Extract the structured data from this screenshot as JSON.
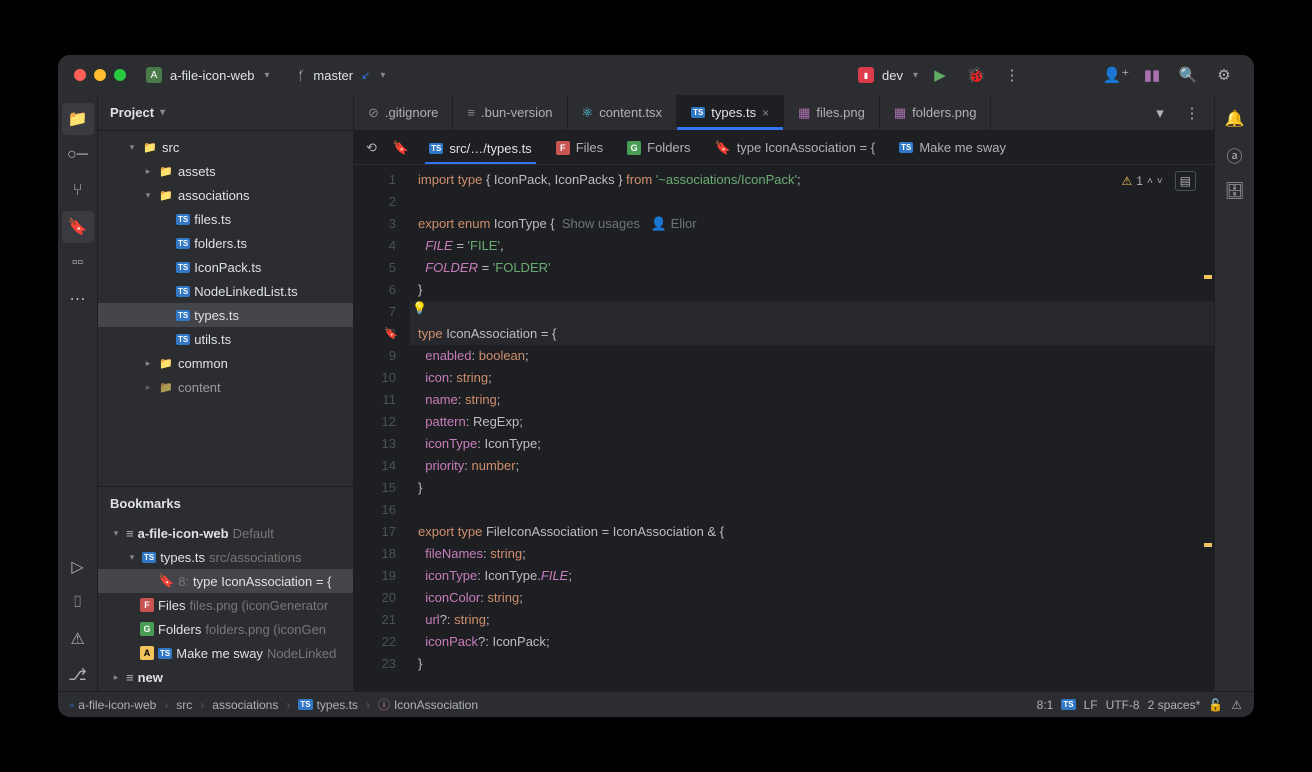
{
  "titlebar": {
    "project_name": "a-file-icon-web",
    "branch_icon": "⎇",
    "branch_name": "master",
    "dev_label": "dev"
  },
  "sidebar": {
    "header": "Project",
    "tree": {
      "src": "src",
      "assets": "assets",
      "associations": "associations",
      "files_ts": "files.ts",
      "folders_ts": "folders.ts",
      "iconpack_ts": "IconPack.ts",
      "nodelist_ts": "NodeLinkedList.ts",
      "types_ts": "types.ts",
      "utils_ts": "utils.ts",
      "common": "common",
      "content": "content"
    },
    "bookmarks_header": "Bookmarks",
    "bookmarks": {
      "root": "a-file-icon-web",
      "root_suffix": "Default",
      "types_ts": "types.ts",
      "types_ts_path": "src/associations",
      "line8_prefix": "8:",
      "line8_text": "type IconAssociation = {",
      "files": "Files",
      "files_dim": "files.png  (iconGenerator",
      "folders": "Folders",
      "folders_dim": "folders.png  (iconGen",
      "makemesway": "Make me sway",
      "makemesway_dim": "NodeLinked",
      "new": "new"
    }
  },
  "tabs": {
    "gitignore": ".gitignore",
    "bunversion": ".bun-version",
    "content": "content.tsx",
    "types": "types.ts",
    "filespng": "files.png",
    "folderspng": "folders.png"
  },
  "bmbar": {
    "path": "src/…/types.ts",
    "files": "Files",
    "folders": "Folders",
    "iconassoc": "type IconAssociation = {",
    "makemesway": "Make me sway"
  },
  "code": {
    "l1_a": "import",
    "l1_b": "type",
    "l1_c": "{ IconPack, IconPacks }",
    "l1_d": "from",
    "l1_e": "'~associations/IconPack'",
    "l1_f": ";",
    "l3_a": "export",
    "l3_b": "enum",
    "l3_c": "IconType {",
    "l3_hint1": "Show usages",
    "l3_hint2": "Elior",
    "l4_a": "FILE",
    "l4_b": " = ",
    "l4_c": "'FILE'",
    "l4_d": ",",
    "l5_a": "FOLDER",
    "l5_b": " = ",
    "l5_c": "'FOLDER'",
    "l6": "}",
    "l8_a": "type",
    "l8_b": " IconAssociation = {",
    "l9_a": "enabled",
    "l9_b": ": ",
    "l9_c": "boolean",
    "l9_d": ";",
    "l10_a": "icon",
    "l10_b": ": ",
    "l10_c": "string",
    "l10_d": ";",
    "l11_a": "name",
    "l11_b": ": ",
    "l11_c": "string",
    "l11_d": ";",
    "l12_a": "pattern",
    "l12_b": ": ",
    "l12_c": "RegExp",
    "l12_d": ";",
    "l13_a": "iconType",
    "l13_b": ": ",
    "l13_c": "IconType",
    "l13_d": ";",
    "l14_a": "priority",
    "l14_b": ": ",
    "l14_c": "number",
    "l14_d": ";",
    "l15": "}",
    "l17_a": "export",
    "l17_b": "type",
    "l17_c": " FileIconAssociation = IconAssociation & {",
    "l18_a": "fileNames",
    "l18_b": ": ",
    "l18_c": "string",
    "l18_d": ";",
    "l19_a": "iconType",
    "l19_b": ": ",
    "l19_c1": "IconType.",
    "l19_c2": "FILE",
    "l19_d": ";",
    "l20_a": "iconColor",
    "l20_b": ": ",
    "l20_c": "string",
    "l20_d": ";",
    "l21_a": "url",
    "l21_b": "?: ",
    "l21_c": "string",
    "l21_d": ";",
    "l22_a": "iconPack",
    "l22_b": "?: ",
    "l22_c": "IconPack",
    "l22_d": ";",
    "l23": "}"
  },
  "inspection": {
    "warn_count": "1"
  },
  "statusbar": {
    "c1": "a-file-icon-web",
    "c2": "src",
    "c3": "associations",
    "c4": "types.ts",
    "c5": "IconAssociation",
    "pos": "8:1",
    "lf": "LF",
    "enc": "UTF-8",
    "indent": "2 spaces*"
  }
}
